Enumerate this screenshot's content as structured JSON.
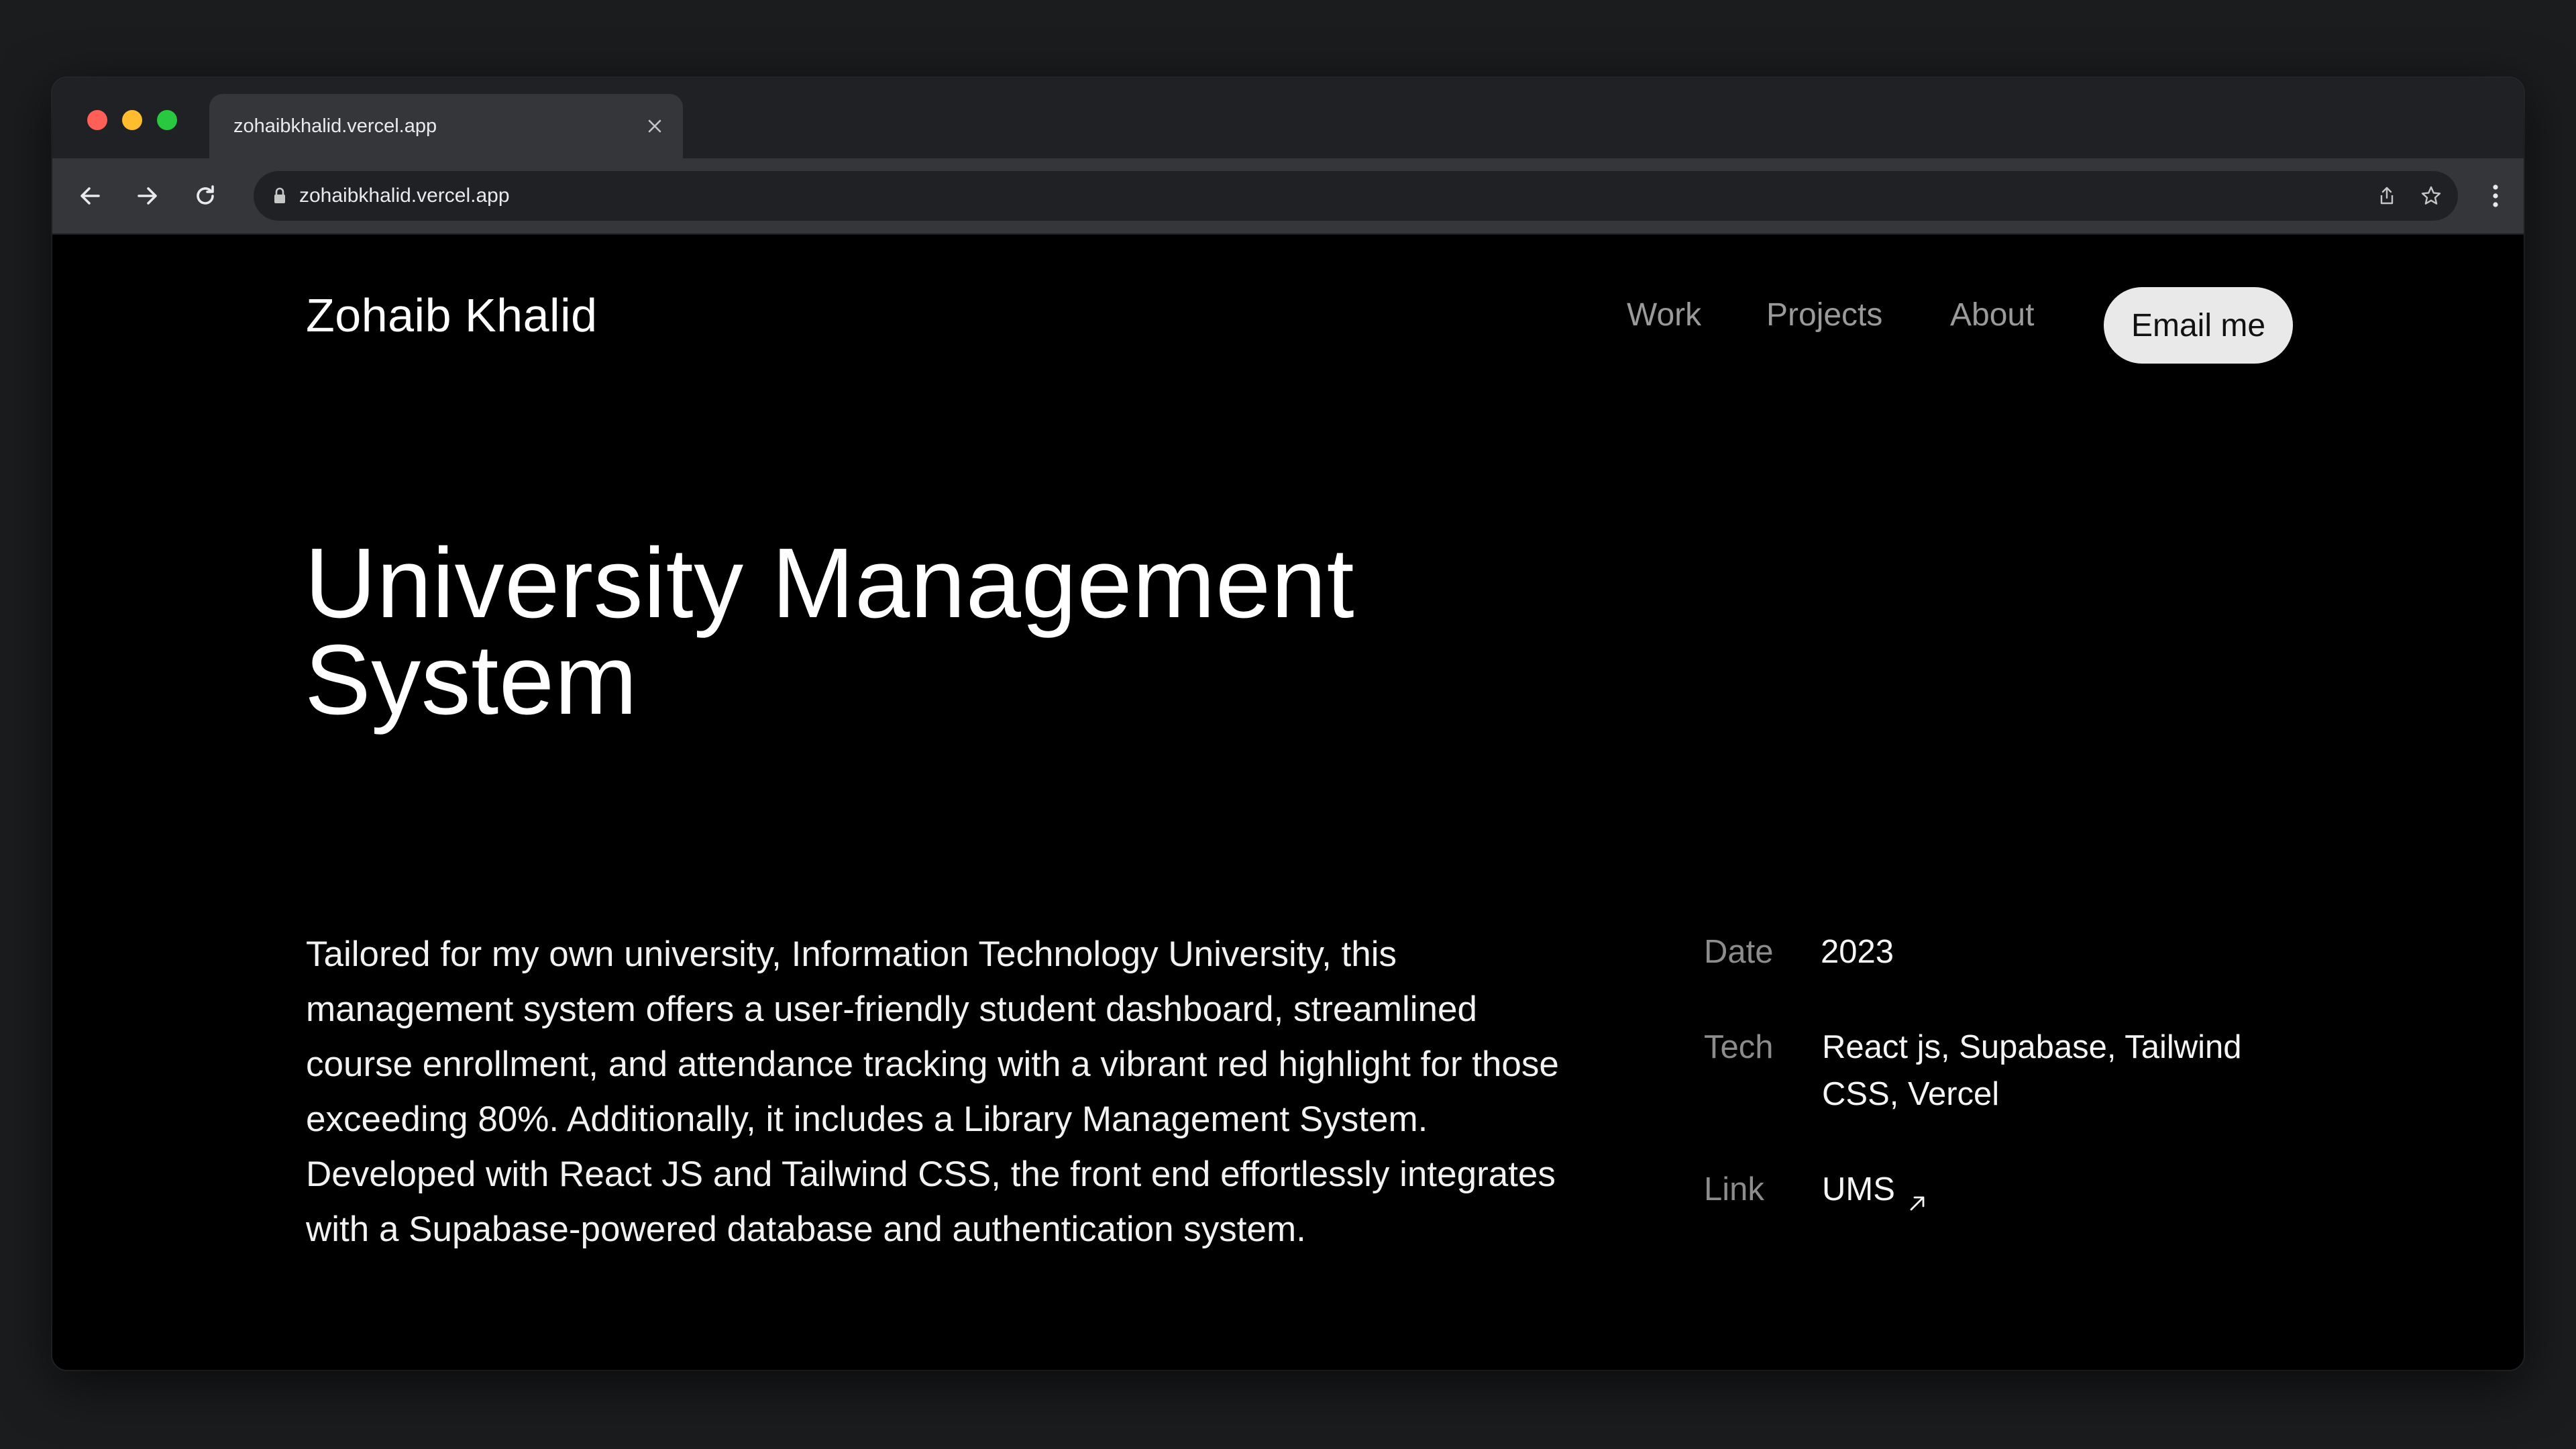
{
  "browser": {
    "tab_title": "zohaibkhalid.vercel.app",
    "url": "zohaibkhalid.vercel.app",
    "icons": {
      "back": "arrow-left-icon",
      "forward": "arrow-right-icon",
      "reload": "reload-icon",
      "lock": "lock-icon",
      "share": "share-icon",
      "bookmark": "star-icon",
      "menu": "more-vertical-icon",
      "close_tab": "close-icon"
    }
  },
  "header": {
    "brand": "Zohaib Khalid",
    "nav": [
      {
        "label": "Work"
      },
      {
        "label": "Projects"
      },
      {
        "label": "About"
      }
    ],
    "cta_label": "Email me"
  },
  "project": {
    "title": "University Management System",
    "description": "Tailored for my own university, Information Technology University, this management system offers a user-friendly student dashboard, streamlined course enrollment, and attendance tracking with a vibrant red highlight for those exceeding 80%. Additionally, it includes a Library Management System. Developed with React JS and Tailwind CSS, the front end effortlessly integrates with a Supabase-powered database and authentication system.",
    "meta": {
      "date_label": "Date",
      "date_value": "2023",
      "tech_label": "Tech",
      "tech_value": "React js, Supabase, Tailwind CSS, Vercel",
      "link_label": "Link",
      "link_value": "UMS"
    }
  },
  "colors": {
    "page_background": "#000000",
    "text_primary": "#ffffff",
    "text_muted": "#9a9a9a",
    "cta_background": "#e9e9e9"
  }
}
